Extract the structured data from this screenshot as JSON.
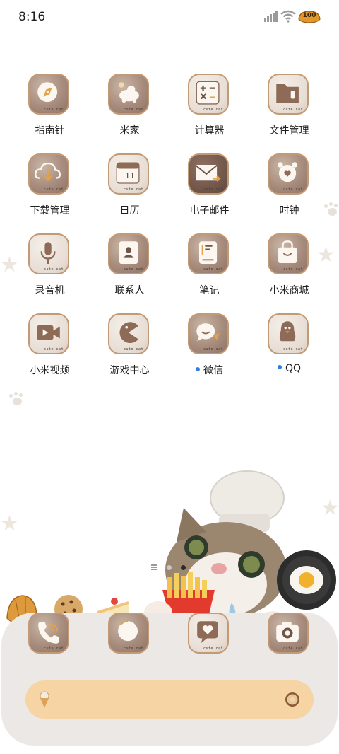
{
  "status_bar": {
    "time": "8:16",
    "battery_level": "100"
  },
  "apps": [
    {
      "label": "指南针",
      "icon": "compass-icon",
      "dot": false
    },
    {
      "label": "米家",
      "icon": "mijia-icon",
      "dot": false
    },
    {
      "label": "计算器",
      "icon": "calculator-icon",
      "dot": false
    },
    {
      "label": "文件管理",
      "icon": "folder-icon",
      "dot": false
    },
    {
      "label": "下载管理",
      "icon": "download-icon",
      "dot": false
    },
    {
      "label": "日历",
      "icon": "calendar-icon",
      "dot": false,
      "calendar_day": "11"
    },
    {
      "label": "电子邮件",
      "icon": "mail-icon",
      "dot": false
    },
    {
      "label": "时钟",
      "icon": "alarm-clock-icon",
      "dot": false
    },
    {
      "label": "录音机",
      "icon": "microphone-icon",
      "dot": false
    },
    {
      "label": "联系人",
      "icon": "contacts-icon",
      "dot": false
    },
    {
      "label": "笔记",
      "icon": "notes-icon",
      "dot": false
    },
    {
      "label": "小米商城",
      "icon": "shopping-bag-icon",
      "dot": false
    },
    {
      "label": "小米视频",
      "icon": "video-icon",
      "dot": false
    },
    {
      "label": "游戏中心",
      "icon": "pacman-icon",
      "dot": false
    },
    {
      "label": "微信",
      "icon": "wechat-icon",
      "dot": true
    },
    {
      "label": "QQ",
      "icon": "penguin-icon",
      "dot": true
    }
  ],
  "icon_badge_text": "cute cat",
  "dock": [
    {
      "icon": "phone-icon"
    },
    {
      "icon": "browser-icon"
    },
    {
      "icon": "heart-message-icon"
    },
    {
      "icon": "camera-icon"
    }
  ],
  "colors": {
    "tile_border": "#c39a76",
    "notification_dot": "#2f7de1",
    "dock_background": "#ece8e6",
    "search_bar": "#f6d4a3"
  }
}
